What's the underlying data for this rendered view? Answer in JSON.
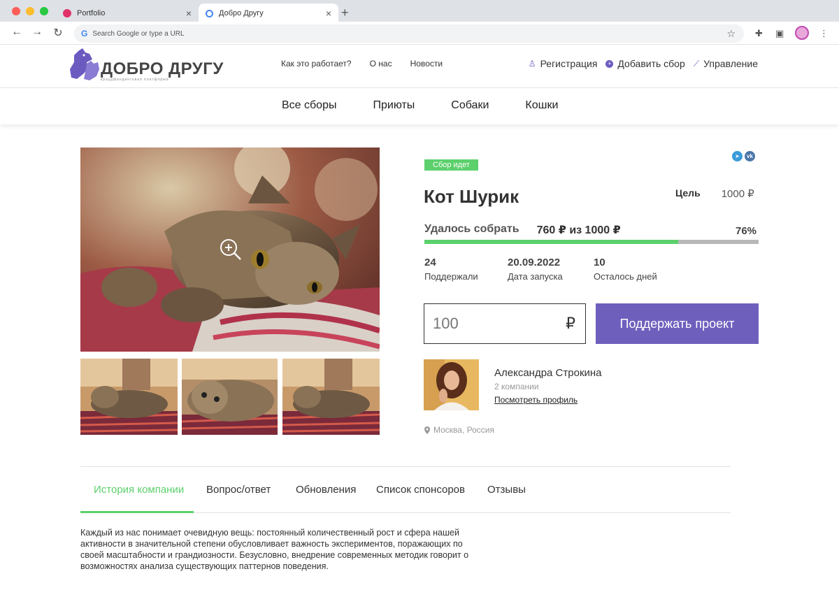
{
  "browser": {
    "tabs": [
      {
        "title": "Portfolio",
        "active": false,
        "favicon_color": "#e0336a"
      },
      {
        "title": "Добро Другу",
        "active": true,
        "favicon_color": "#4285f4"
      }
    ],
    "address_placeholder": "Search Google or type a URL"
  },
  "header": {
    "logo_text": "ДОБРО ДРУГУ",
    "logo_sub": "краудфандинговая платформа",
    "nav": [
      "Как это работает?",
      "О нас",
      "Новости"
    ],
    "actions": {
      "register": "Регистрация",
      "add": "Добавить сбор",
      "manage": "Управление"
    }
  },
  "categories": [
    "Все сборы",
    "Приюты",
    "Собаки",
    "Кошки"
  ],
  "campaign": {
    "status": "Сбор идет",
    "name": "Кот Шурик",
    "goal_label": "Цель",
    "goal_value": "1000 ₽",
    "raised_label": "Удалось собрать",
    "raised_value": "760 ₽ из 1000 ₽",
    "percent": "76%",
    "progress_fraction": 0.76,
    "stats": [
      {
        "num": "24",
        "cap": "Поддержали"
      },
      {
        "num": "20.09.2022",
        "cap": "Дата запуска"
      },
      {
        "num": "10",
        "cap": "Осталось дней"
      }
    ],
    "amount_placeholder": "100",
    "currency": "₽",
    "support_button": "Поддержать проект"
  },
  "author": {
    "name": "Александра Строкина",
    "companies": "2 компании",
    "profile_link": "Посмотреть профиль",
    "location": "Москва, Россия"
  },
  "tabs": [
    "История компании",
    "Вопрос/ответ",
    "Обновления",
    "Список спонсоров",
    "Отзывы"
  ],
  "story": "Каждый из нас понимает очевидную вещь: постоянный количественный рост и сфера нашей активности в значительной степени обусловливает важность экспериментов, поражающих по своей масштабности и грандиозности. Безусловно, внедрение современных методик говорит о возможностях анализа существующих паттернов поведения.",
  "colors": {
    "accent": "#6f5fbd",
    "green": "#5cd06c",
    "telegram": "#3a9bd9",
    "vk": "#4a76a8"
  }
}
